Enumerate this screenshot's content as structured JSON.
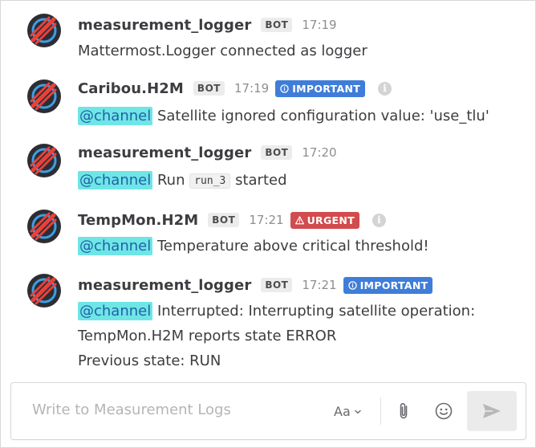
{
  "posts": [
    {
      "username": "measurement_logger",
      "bot_tag": "BOT",
      "time": "17:19",
      "badge": null,
      "lines": [
        "Mattermost.Logger connected as logger"
      ]
    },
    {
      "username": "Caribou.H2M",
      "bot_tag": "BOT",
      "time": "17:19",
      "badge": {
        "label": "IMPORTANT",
        "kind": "important",
        "icon": "info-circle-icon"
      },
      "mention": "@channel",
      "text": "Satellite ignored configuration value: 'use_tlu'"
    },
    {
      "username": "measurement_logger",
      "bot_tag": "BOT",
      "time": "17:20",
      "mention": "@channel",
      "text_before_code": "Run",
      "code": "run_3",
      "text_after_code": "started"
    },
    {
      "username": "TempMon.H2M",
      "bot_tag": "BOT",
      "time": "17:21",
      "badge": {
        "label": "URGENT",
        "kind": "urgent",
        "icon": "warning-triangle-icon"
      },
      "mention": "@channel",
      "text": "Temperature above critical threshold!"
    },
    {
      "username": "measurement_logger",
      "bot_tag": "BOT",
      "time": "17:21",
      "badge": {
        "label": "IMPORTANT",
        "kind": "important",
        "icon": "info-circle-icon"
      },
      "mention": "@channel",
      "text": "Interrupted: Interrupting satellite operation:",
      "line2": "TempMon.H2M reports state ERROR",
      "line3": "Previous state: RUN"
    }
  ],
  "composer": {
    "placeholder": "Write to Measurement Logs",
    "format_label": "Aa",
    "format_icon": "chevron-down-icon",
    "attach_icon": "paperclip-icon",
    "emoji_icon": "smiley-icon",
    "send_icon": "send-icon"
  },
  "colors": {
    "important": "#3f7dd9",
    "urgent": "#d24b4e",
    "mention_bg": "#6ee6e6",
    "mention_text": "#2361a8",
    "avatar_red": "#e8413b",
    "avatar_dark": "#2d2d33",
    "avatar_blue": "#3aa0e6"
  }
}
